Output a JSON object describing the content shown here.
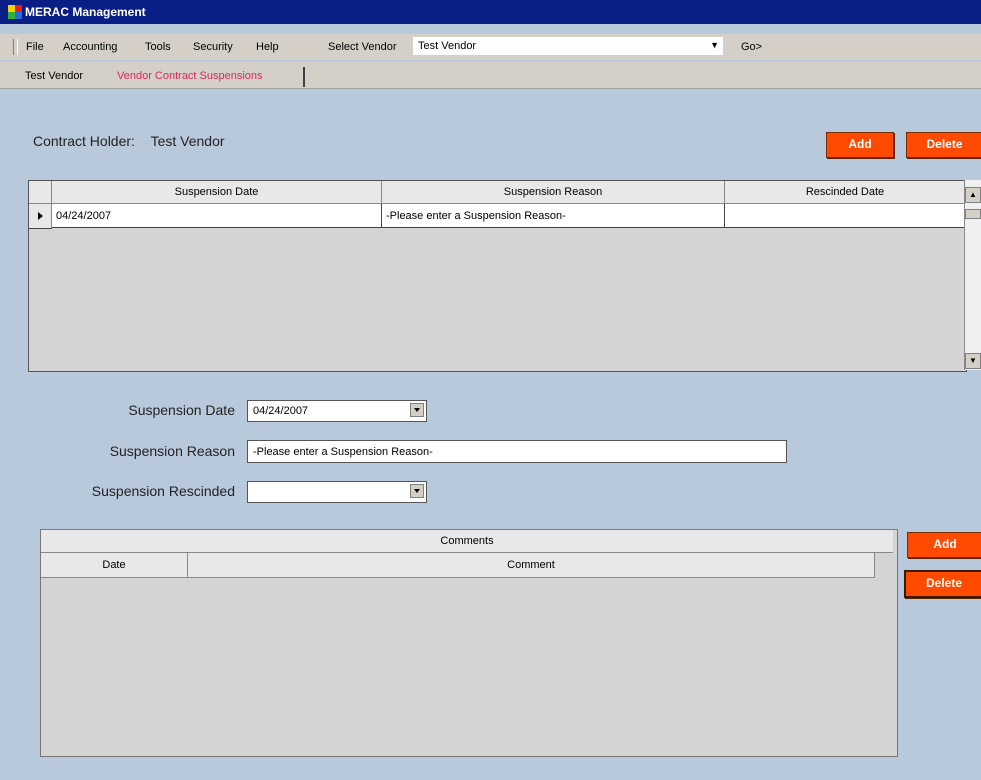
{
  "window": {
    "title": "MERAC Management"
  },
  "menu": {
    "items": [
      "File",
      "Accounting",
      "Tools",
      "Security",
      "Help"
    ],
    "vendor_label": "Select Vendor",
    "vendor_value": "Test Vendor",
    "go_label": "Go>"
  },
  "tabs": [
    {
      "label": "Test Vendor",
      "active": false
    },
    {
      "label": "Vendor Contract Suspensions",
      "active": true
    }
  ],
  "contract_holder": {
    "label": "Contract Holder:",
    "value": "Test Vendor"
  },
  "buttons": {
    "add": "Add",
    "delete": "Delete"
  },
  "suspensions_grid": {
    "columns": [
      "Suspension Date",
      "Suspension Reason",
      "Rescinded Date"
    ],
    "rows": [
      {
        "date": "04/24/2007",
        "reason": "-Please enter a Suspension Reason-",
        "rescinded": ""
      }
    ]
  },
  "form": {
    "date_label": "Suspension Date",
    "date_value": "04/24/2007",
    "reason_label": "Suspension Reason",
    "reason_value": "-Please enter a Suspension Reason-",
    "rescinded_label": "Suspension Rescinded",
    "rescinded_value": ""
  },
  "comments_grid": {
    "caption": "Comments",
    "columns": [
      "Date",
      "Comment"
    ]
  },
  "colors": {
    "titlebar": "#0a1f86",
    "background": "#b9c9dc",
    "button": "#ff4a00",
    "active_tab": "#e0245e"
  }
}
